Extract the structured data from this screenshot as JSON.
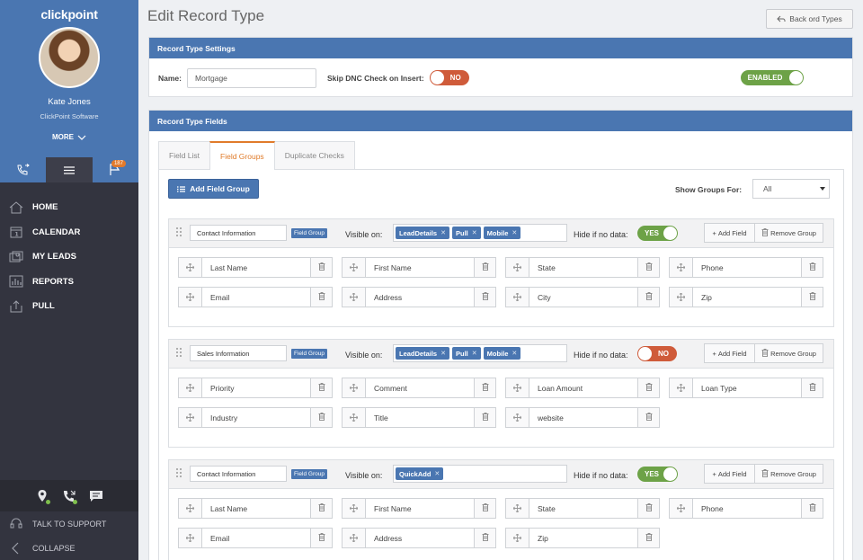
{
  "sidebar": {
    "logo": "clickpoint",
    "user_name": "Kate Jones",
    "company": "ClickPoint Software",
    "more_label": "MORE",
    "flag_badge": "187",
    "nav": [
      {
        "label": "HOME",
        "icon": "home-icon"
      },
      {
        "label": "CALENDAR",
        "icon": "calendar-icon"
      },
      {
        "label": "MY LEADS",
        "icon": "leads-icon"
      },
      {
        "label": "REPORTS",
        "icon": "reports-icon"
      },
      {
        "label": "PULL",
        "icon": "pull-icon"
      }
    ],
    "support_label": "TALK TO SUPPORT",
    "collapse_label": "COLLAPSE"
  },
  "header": {
    "title": "Edit Record Type",
    "back_label": "Back ord Types"
  },
  "settings": {
    "panel_title": "Record Type Settings",
    "name_label": "Name:",
    "name_value": "Mortgage",
    "skip_dnc_label": "Skip DNC Check on Insert:",
    "skip_dnc_toggle": "NO",
    "enabled_toggle": "ENABLED"
  },
  "fields_panel": {
    "panel_title": "Record Type Fields",
    "tabs": [
      "Field List",
      "Field Groups",
      "Duplicate Checks"
    ],
    "active_tab": "Field Groups",
    "add_group_label": "Add Field Group",
    "show_groups_label": "Show Groups For:",
    "show_groups_value": "All",
    "visible_on_label": "Visible on:",
    "hide_label": "Hide if no data:",
    "group_tag": "Field Group",
    "add_field_label": "Add Field",
    "remove_group_label": "Remove Group",
    "groups": [
      {
        "name": "Contact Information",
        "chips": [
          "LeadDetails",
          "Pull",
          "Mobile"
        ],
        "hide_toggle": "YES",
        "fields": [
          "Last Name",
          "First Name",
          "State",
          "Phone",
          "Email",
          "Address",
          "City",
          "Zip"
        ]
      },
      {
        "name": "Sales Information",
        "chips": [
          "LeadDetails",
          "Pull",
          "Mobile"
        ],
        "hide_toggle": "NO",
        "fields": [
          "Priority",
          "Comment",
          "Loan Amount",
          "Loan Type",
          "Industry",
          "Title",
          "website"
        ]
      },
      {
        "name": "Contact Information",
        "chips": [
          "QuickAdd"
        ],
        "hide_toggle": "YES",
        "fields": [
          "Last Name",
          "First Name",
          "State",
          "Phone",
          "Email",
          "Address",
          "Zip"
        ]
      }
    ]
  },
  "colors": {
    "brand_blue": "#4a76b1",
    "sidebar_dark": "#33343f",
    "accent_orange": "#e07b2a",
    "toggle_yes": "#6da247",
    "toggle_no": "#cf5b3a"
  }
}
